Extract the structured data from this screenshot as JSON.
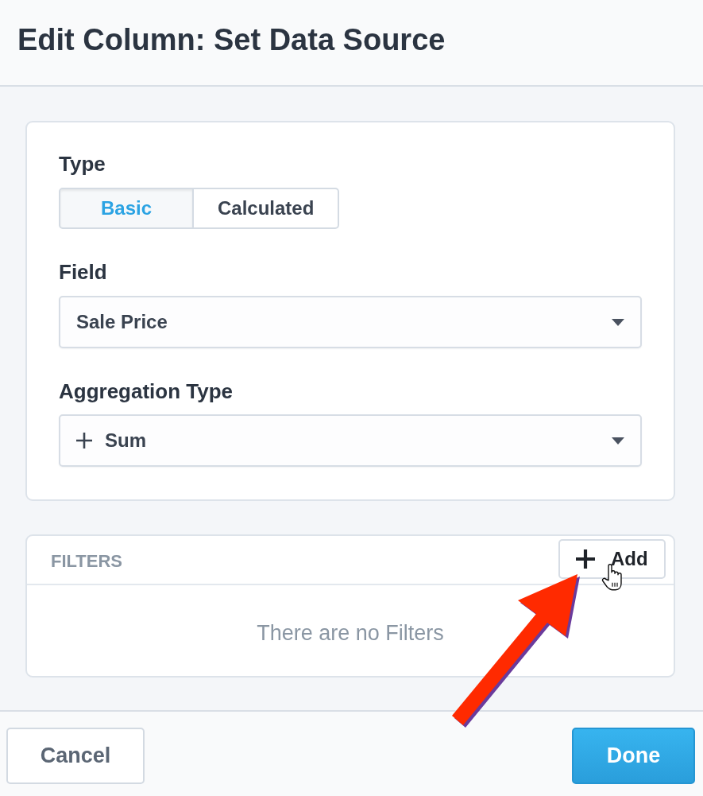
{
  "window": {
    "title": "Edit Column: Set Data Source"
  },
  "type_field": {
    "label": "Type",
    "options": [
      {
        "label": "Basic",
        "selected": true
      },
      {
        "label": "Calculated",
        "selected": false
      }
    ]
  },
  "field": {
    "label": "Field",
    "value": "Sale Price"
  },
  "aggregation": {
    "label": "Aggregation Type",
    "value": "Sum"
  },
  "filters": {
    "title": "FILTERS",
    "add_button": "Add",
    "empty_message": "There are no Filters"
  },
  "buttons": {
    "cancel": "Cancel",
    "done": "Done"
  }
}
